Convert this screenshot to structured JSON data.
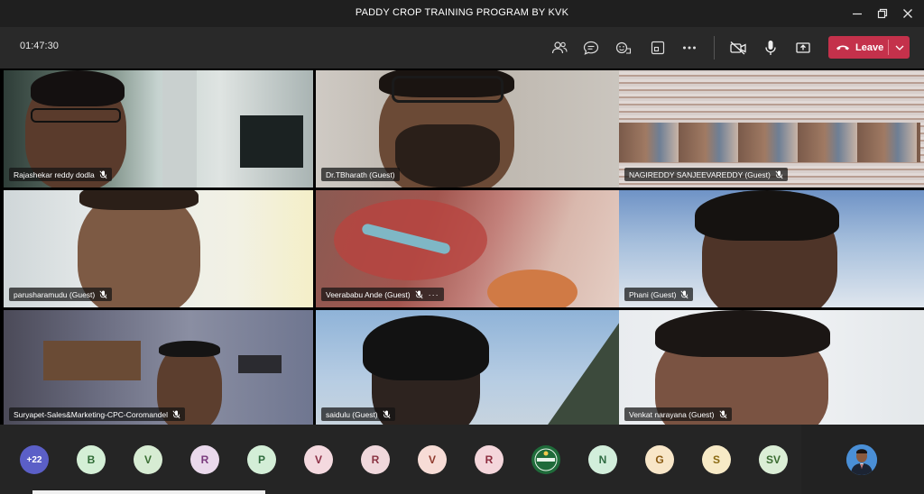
{
  "window": {
    "title": "PADDY CROP TRAINING PROGRAM BY KVK"
  },
  "toolbar": {
    "timer": "01:47:30",
    "leave_label": "Leave",
    "icons": [
      "people-icon",
      "chat-icon",
      "reactions-icon",
      "share-tray-icon",
      "more-icon",
      "camera-off-icon",
      "mic-icon",
      "share-icon"
    ]
  },
  "tiles": [
    {
      "name": "Rajashekar reddy dodla"
    },
    {
      "name": "Dr.TBharath (Guest)"
    },
    {
      "name": "NAGIREDDY SANJEEVAREDDY (Guest)"
    },
    {
      "name": "parusharamudu (Guest)"
    },
    {
      "name": "Veerababu Ande (Guest)",
      "more": "···"
    },
    {
      "name": "Phani (Guest)"
    },
    {
      "name": "Suryapet-Sales&Marketing-CPC-Coromandel"
    },
    {
      "name": "saidulu (Guest)"
    },
    {
      "name": "Venkat narayana (Guest)"
    }
  ],
  "roster": {
    "more_count": "+22",
    "avatars": [
      {
        "initial": "B",
        "bg": "#d4efd6",
        "fg": "#2f6b35"
      },
      {
        "initial": "V",
        "bg": "#d7ecd3",
        "fg": "#3a6e33"
      },
      {
        "initial": "R",
        "bg": "#ead9ec",
        "fg": "#7a3b7e"
      },
      {
        "initial": "P",
        "bg": "#d3eed7",
        "fg": "#2f6b3d"
      },
      {
        "initial": "V",
        "bg": "#f4d9df",
        "fg": "#8c2f45"
      },
      {
        "initial": "R",
        "bg": "#f0d8dc",
        "fg": "#8a3443"
      },
      {
        "initial": "V",
        "bg": "#f7dcd6",
        "fg": "#8f3a2d"
      },
      {
        "initial": "R",
        "bg": "#f4d6db",
        "fg": "#8c2c3e"
      },
      {
        "initial": "",
        "bg": "#1f6b3a",
        "fg": "#ffffff"
      },
      {
        "initial": "N",
        "bg": "#d2eedb",
        "fg": "#2f6b42"
      },
      {
        "initial": "G",
        "bg": "#f8e6c8",
        "fg": "#8a5a12"
      },
      {
        "initial": "S",
        "bg": "#f7eac6",
        "fg": "#8a6a12"
      },
      {
        "initial": "SV",
        "bg": "#dbeed6",
        "fg": "#3a6b30"
      }
    ]
  },
  "colors": {
    "leave": "#c4314b",
    "accent": "#5b5fc7"
  }
}
